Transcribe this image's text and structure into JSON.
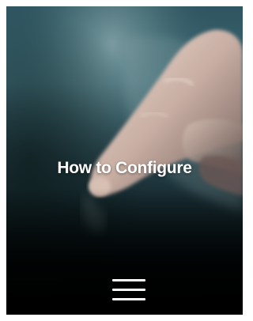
{
  "hero": {
    "title": "How to Configure",
    "image_icon": "hand-touch-image"
  },
  "menu": {
    "icon": "hamburger-menu-icon"
  },
  "colors": {
    "background": "#ffffff",
    "hero_dark": "#0b1a1f",
    "hero_teal": "#3f6d78",
    "text": "#ffffff"
  }
}
